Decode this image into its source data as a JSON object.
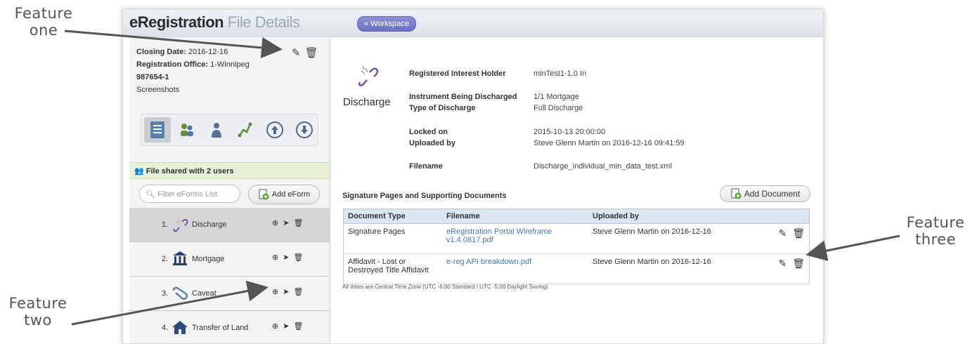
{
  "callouts": {
    "one": "Feature\none",
    "two": "Feature\ntwo",
    "three": "Feature\nthree"
  },
  "header": {
    "title": "eRegistration",
    "subtitle": "File Details",
    "workspace_button": "« Workspace"
  },
  "file": {
    "closing_date_label": "Closing Date:",
    "closing_date": "2016-12-16",
    "office_label": "Registration Office:",
    "office": "1-Winnipeg",
    "number": "987654-1",
    "name": "Screenshots"
  },
  "nav_icons": [
    "file-details-icon",
    "users-icon",
    "person-icon",
    "flow-icon",
    "upload-cloud-icon",
    "download-cloud-icon"
  ],
  "shared": {
    "text": "File shared with 2 users"
  },
  "eforms": {
    "filter_placeholder": "Filter eForms List",
    "add_label": "Add eForm",
    "items": [
      {
        "num": "1.",
        "label": "Discharge",
        "icon": "broken-chain-icon"
      },
      {
        "num": "2.",
        "label": "Mortgage",
        "icon": "bank-icon"
      },
      {
        "num": "3.",
        "label": "Caveat",
        "icon": "paperclip-icon"
      },
      {
        "num": "4.",
        "label": "Transfer of Land",
        "icon": "house-icon"
      }
    ]
  },
  "document": {
    "title": "Discharge",
    "details": [
      {
        "label": "Registered Interest Holder",
        "value": "minTest1-1.0 In"
      },
      {
        "label": "Instrument Being Discharged",
        "value": "1/1 Mortgage"
      },
      {
        "label": "Type of Discharge",
        "value": "Full Discharge"
      },
      {
        "label": "Locked on",
        "value": "2015-10-13 20:00:00"
      },
      {
        "label": "Uploaded by",
        "value": "Steve Glenn Martin on 2016-12-16 09:41:59"
      },
      {
        "label": "Filename",
        "value": "Discharge_individual_min_data_test.xml"
      }
    ]
  },
  "supporting": {
    "heading": "Signature Pages and Supporting Documents",
    "add_label": "Add Document",
    "columns": [
      "Document Type",
      "Filename",
      "Uploaded by"
    ],
    "rows": [
      {
        "type": "Signature Pages",
        "filename": "eRegistration Portal Wireframe v1.4.0817.pdf",
        "uploaded": "Steve Glenn Martin on 2016-12-16"
      },
      {
        "type": "Affidavit - Lost or Destroyed Title Affidavit",
        "filename": "e-reg API breakdown.pdf",
        "uploaded": "Steve Glenn Martin on 2016-12-16"
      }
    ]
  },
  "footnote": "All times are Central Time Zone (UTC -6:00 Standard / UTC -5:00 Daylight Saving)"
}
